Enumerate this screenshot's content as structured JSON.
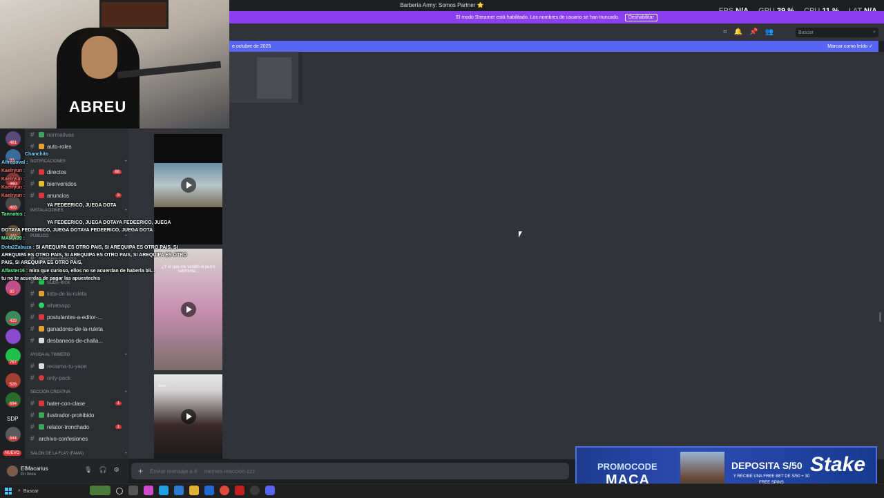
{
  "window": {
    "title": "Barbería Army: Somos Partner ⭐"
  },
  "overlay_stats": {
    "fps_label": "FPS",
    "fps_value": "N/A",
    "gpu_label": "GPU",
    "gpu_value": "39 %",
    "cpu_label": "CPU",
    "cpu_value": "11 %",
    "lat_label": "LAT",
    "lat_value": "N/A"
  },
  "streamer_banner": {
    "text": "El modo Streamer está habilitado. Los nombres de usuario se han truncado.",
    "disable_label": "Deshabilitar"
  },
  "header": {
    "search_placeholder": "Buscar"
  },
  "new_messages_bar": {
    "text": "e octubre de 2025",
    "mark_read_label": "Marcar como leído"
  },
  "channels": {
    "items": [
      {
        "name": "normativas",
        "muted": true
      },
      {
        "name": "auto-roles",
        "muted": false
      },
      {
        "name": "directos",
        "muted": false,
        "badge": "88"
      },
      {
        "name": "bienvenidos",
        "muted": false
      },
      {
        "name": "anuncios",
        "muted": false,
        "badge": "3"
      },
      {
        "name": "subs-kick",
        "muted": true
      },
      {
        "name": "lista-de-la-ruleta",
        "muted": true
      },
      {
        "name": "whatsapp",
        "muted": true
      },
      {
        "name": "postulantes-a-editor-...",
        "muted": false
      },
      {
        "name": "ganadores-de-la-ruleta",
        "muted": false
      },
      {
        "name": "desbaneos-de-challa...",
        "muted": false
      },
      {
        "name": "reclama-tu-yape",
        "muted": true
      },
      {
        "name": "only-pack",
        "muted": true
      },
      {
        "name": "hater-con-clase",
        "muted": false,
        "badge": "1"
      },
      {
        "name": "ilustrador-prohibido",
        "muted": false
      },
      {
        "name": "relator-tronchado",
        "muted": false,
        "badge": "1"
      },
      {
        "name": "archivo-confesiones",
        "muted": false
      }
    ],
    "categories": {
      "notificaciones": "NOTIFICACIONES",
      "instalaciones": "INSTALACIONES",
      "publico": "PÚBLICO",
      "ayuda": "AYUDA AL TIMBERO",
      "creativa": "SECCIÓN CREATIVA",
      "salon": "SALÓN DE LA FLA? (FAMA)"
    },
    "memes_channel": "memes-reaccio..."
  },
  "server_rail": {
    "badges": [
      "481",
      "93",
      "460",
      "469",
      "483",
      "80",
      "429",
      "767",
      "526",
      "694",
      "644"
    ],
    "sdp_label": "SDP",
    "new_label": "NUEVO"
  },
  "chat_overlay": [
    {
      "user": "Chanchito",
      "text": ""
    },
    {
      "user": "Alfredoval :",
      "text": ""
    },
    {
      "user": "Kaelryun :",
      "text": ""
    },
    {
      "user": "Kaelryun :",
      "text": ""
    },
    {
      "user": "Kaelryun :",
      "text": ""
    },
    {
      "user": "Kaelryun :",
      "text": ""
    },
    {
      "user": "",
      "text": "YA FEDEERICO, JUEGA DOTA"
    },
    {
      "user": "Tannatos :",
      "text": ""
    },
    {
      "user": "",
      "text": "YA FEDEERICO, JUEGA DOTAYA FEDEERICO, JUEGA"
    },
    {
      "user": "",
      "text": "DOTAYA FEDEERICO, JUEGA DOTAYA FEDEERICO, JUEGA DOTA"
    },
    {
      "user": "MAMA99 :",
      "text": ""
    },
    {
      "user": "Dota2Zabuza :",
      "text": "SI AREQUIPA ES OTRO PAIS, SI AREQUIPA ES OTRO PAIS, SI"
    },
    {
      "user": "",
      "text": "AREQUIPA ES OTRO PAIS, SI AREQUIPA ES OTRO PAIS, SI AREQUIPA ES OTRO"
    },
    {
      "user": "",
      "text": "PAIS, SI AREQUIPA ES OTRO PAIS,"
    },
    {
      "user": "Alfaster16 :",
      "text": "mira que curioso, ellos no se acuerdan de haberla bli..."
    },
    {
      "user": "",
      "text": "tu no te acuerdas de pagar las apuestechis"
    }
  ],
  "memes": {
    "caption": "¿Y el que me vendió el perro salchicha...",
    "sora_label": "Sora"
  },
  "user_panel": {
    "username": "ElMacarius",
    "status": "En línea"
  },
  "message_bar": {
    "placeholder": "Enviar mensaje a #",
    "channel": "memes-reaccion-zzz"
  },
  "ad": {
    "promocode_label": "PROMOCODE",
    "code": "MACA",
    "deposit": "DEPOSITA S/50",
    "deposit_sub": "Y RECIBE UNA FREE BET DE S/50 + 30 FREE SPINS",
    "brand": "Stake"
  },
  "taskbar": {
    "search_label": "Buscar"
  },
  "colors": {
    "banner": "#8b3ff0",
    "new_bar": "#5865f2",
    "badge": "#da373c",
    "ad_bg": "#1d3c8f"
  }
}
